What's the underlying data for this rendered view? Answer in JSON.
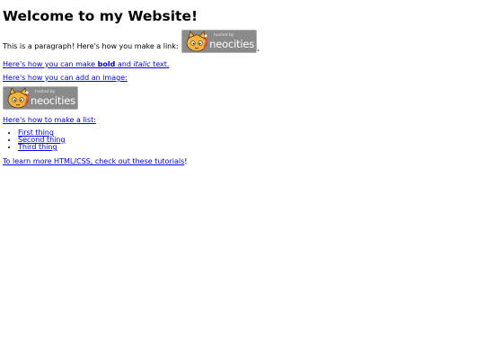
{
  "heading": "Welcome to my Website!",
  "link_paragraph": {
    "text": "This is a paragraph! Here's how you make a link:",
    "trailing": ","
  },
  "badge": {
    "hosted_text": "hosted by",
    "brand_text": "neocities"
  },
  "formatting": {
    "before": "Here's how you can make ",
    "bold": "bold",
    "middle": " and ",
    "italic": "italic",
    "after": " text."
  },
  "image_line": "Here's how you can add an image:",
  "list_intro": "Here's how to make a list:",
  "list_items": [
    "First thing",
    "Second thing",
    "Third thing"
  ],
  "tutorial_line": {
    "link_text": "To learn more HTML/CSS, check out these tutorials",
    "trailing": "!"
  }
}
